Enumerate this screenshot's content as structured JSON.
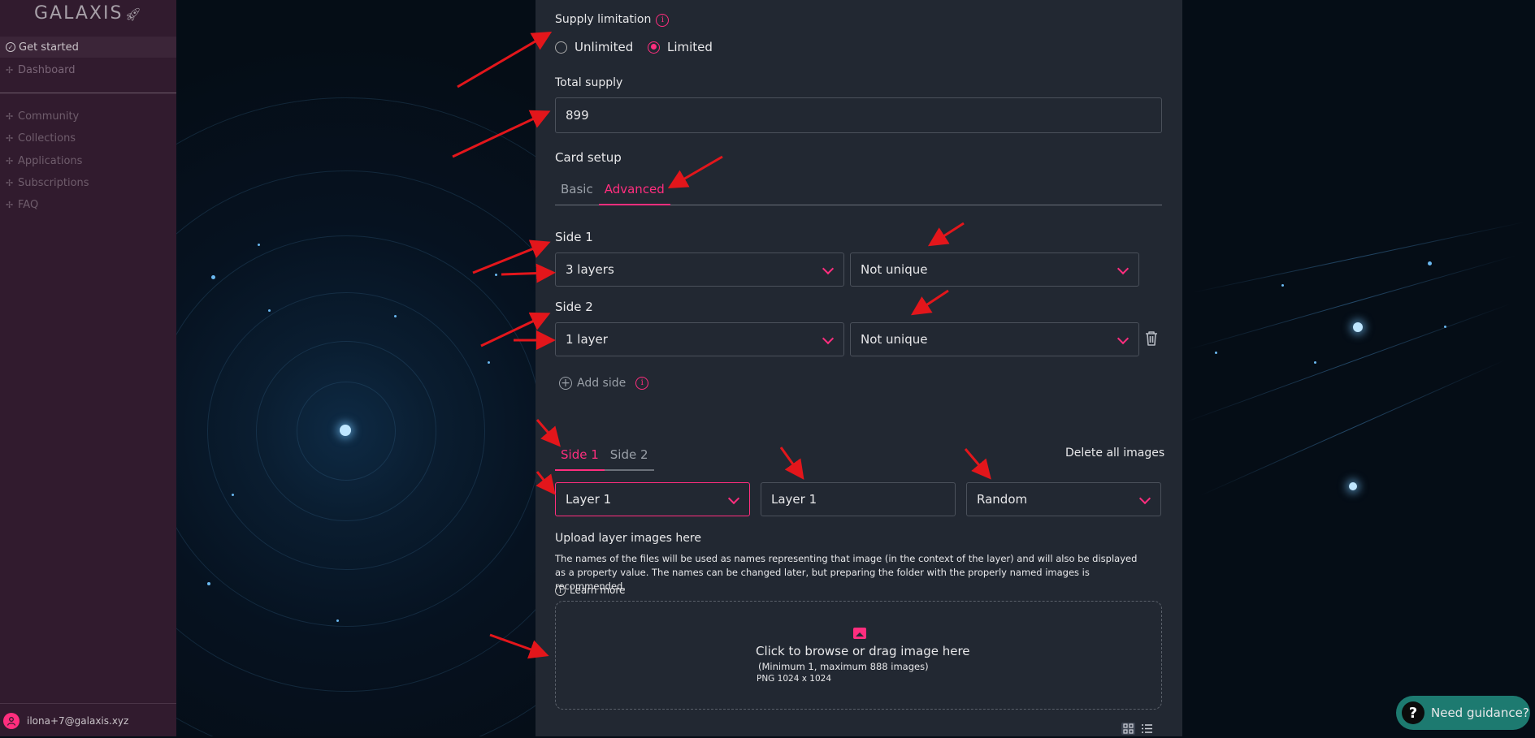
{
  "sidebar": {
    "logo": "GALAXIS",
    "items": [
      {
        "label": "Get started",
        "icon": "check-circle-icon"
      },
      {
        "label": "Dashboard",
        "icon": "dashboard-icon"
      },
      {
        "label": "Community",
        "icon": "community-icon"
      },
      {
        "label": "Collections",
        "icon": "collections-icon"
      },
      {
        "label": "Applications",
        "icon": "applications-icon"
      },
      {
        "label": "Subscriptions",
        "icon": "subscriptions-icon"
      },
      {
        "label": "FAQ",
        "icon": "faq-icon"
      }
    ],
    "user_email": "ilona+7@galaxis.xyz"
  },
  "form": {
    "supply_limitation_label": "Supply limitation",
    "supply_options": [
      "Unlimited",
      "Limited"
    ],
    "supply_selected": "Limited",
    "total_supply_label": "Total supply",
    "total_supply_value": "899",
    "card_setup_label": "Card setup",
    "card_tabs": [
      "Basic",
      "Advanced"
    ],
    "card_tab_active": "Advanced",
    "side1_label": "Side 1",
    "side1_layers": "3 layers",
    "side1_uniqueness": "Not unique",
    "side2_label": "Side 2",
    "side2_layers": "1 layer",
    "side2_uniqueness": "Not unique",
    "add_side_label": "Add side",
    "side_tabs": [
      "Side 1",
      "Side 2"
    ],
    "side_tab_active": "Side 1",
    "delete_all_label": "Delete all images",
    "layer_select": "Layer 1",
    "layer_name_value": "Layer 1",
    "order_select": "Random",
    "upload_title": "Upload layer images here",
    "upload_description": "The names of the files will be used as names representing that image (in the context of the layer) and will also be displayed as a property value. The names can be changed later, but preparing the folder with the properly named images is recommended.",
    "learn_more": "Learn more",
    "dropzone_title": "Click to browse or drag image here",
    "dropzone_limits": "(Minimum 1, maximum 888 images)",
    "dropzone_format": "PNG 1024 x 1024"
  },
  "guidance_label": "Need guidance?",
  "colors": {
    "accent": "#ff2e7e",
    "sidebar_bg": "#311b2e",
    "panel_bg": "#222832",
    "guidance_bg": "#1d7a70",
    "annotation_arrow": "#e3161b"
  }
}
